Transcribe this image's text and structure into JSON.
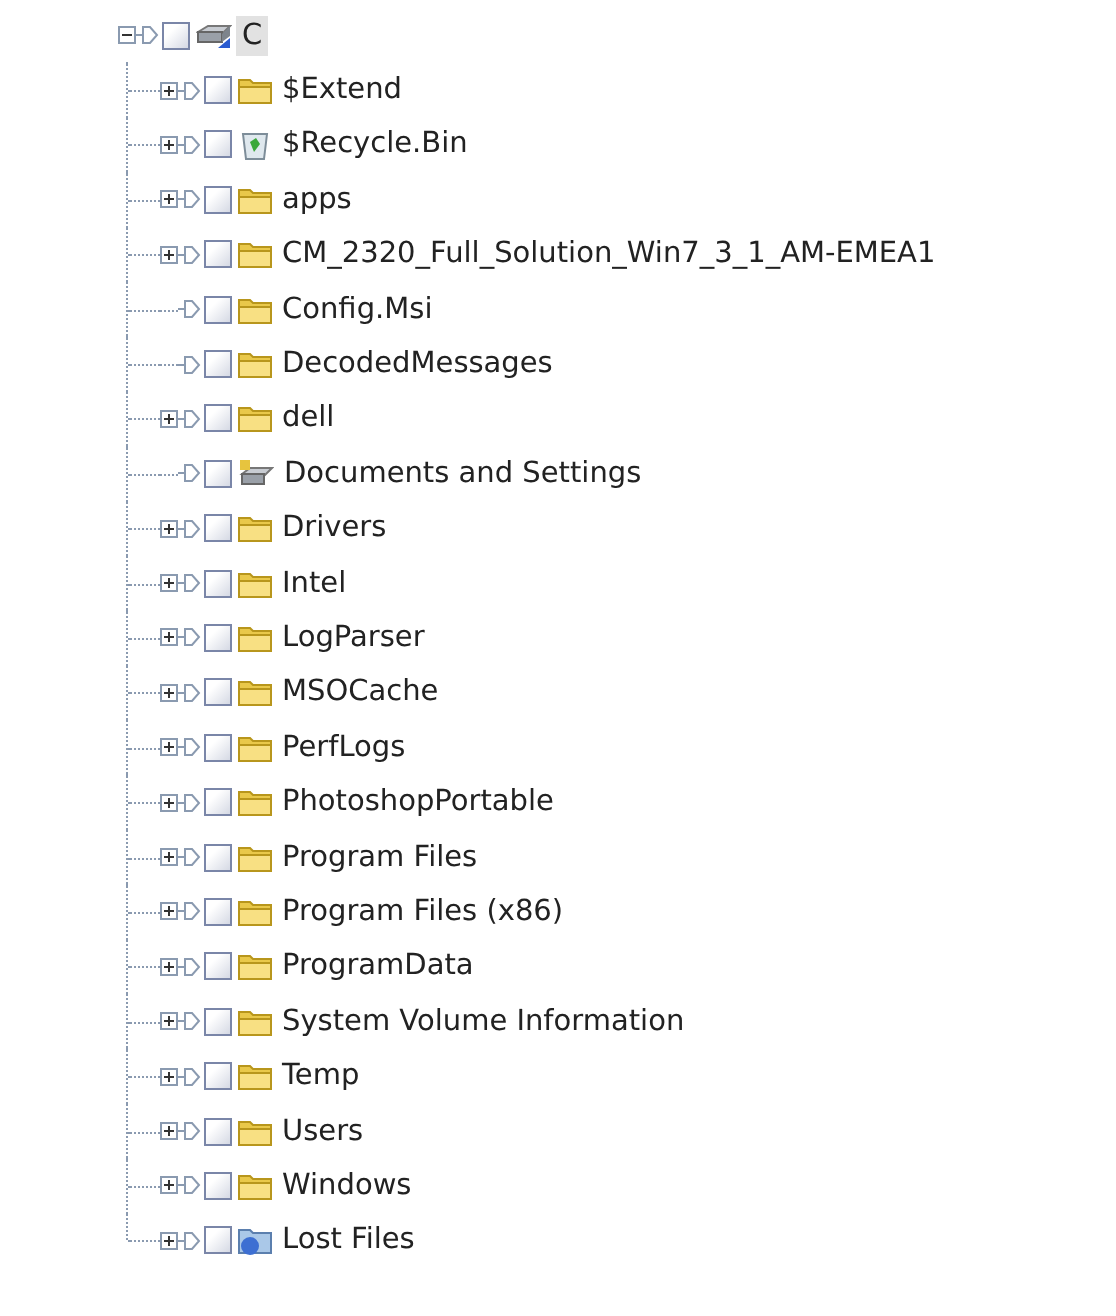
{
  "tree": {
    "label": "C",
    "kind": "drive",
    "selected": true,
    "expanded": true,
    "checked": false,
    "children": [
      {
        "label": "$Extend",
        "kind": "folder",
        "has_children": true,
        "checked": false,
        "selected": false
      },
      {
        "label": "$Recycle.Bin",
        "kind": "recycle",
        "has_children": true,
        "checked": false,
        "selected": false
      },
      {
        "label": "apps",
        "kind": "folder",
        "has_children": true,
        "checked": false,
        "selected": false
      },
      {
        "label": "CM_2320_Full_Solution_Win7_3_1_AM-EMEA1",
        "kind": "folder",
        "has_children": true,
        "checked": false,
        "selected": false
      },
      {
        "label": "Config.Msi",
        "kind": "folder",
        "has_children": false,
        "checked": false,
        "selected": false
      },
      {
        "label": "DecodedMessages",
        "kind": "folder",
        "has_children": false,
        "checked": false,
        "selected": false
      },
      {
        "label": "dell",
        "kind": "folder",
        "has_children": true,
        "checked": false,
        "selected": false
      },
      {
        "label": "Documents and Settings",
        "kind": "link",
        "has_children": false,
        "checked": false,
        "selected": false
      },
      {
        "label": "Drivers",
        "kind": "folder",
        "has_children": true,
        "checked": false,
        "selected": false
      },
      {
        "label": "Intel",
        "kind": "folder",
        "has_children": true,
        "checked": false,
        "selected": false
      },
      {
        "label": "LogParser",
        "kind": "folder",
        "has_children": true,
        "checked": false,
        "selected": false
      },
      {
        "label": "MSOCache",
        "kind": "folder",
        "has_children": true,
        "checked": false,
        "selected": false
      },
      {
        "label": "PerfLogs",
        "kind": "folder",
        "has_children": true,
        "checked": false,
        "selected": false
      },
      {
        "label": "PhotoshopPortable",
        "kind": "folder",
        "has_children": true,
        "checked": false,
        "selected": false
      },
      {
        "label": "Program Files",
        "kind": "folder",
        "has_children": true,
        "checked": false,
        "selected": false
      },
      {
        "label": "Program Files (x86)",
        "kind": "folder",
        "has_children": true,
        "checked": false,
        "selected": false
      },
      {
        "label": "ProgramData",
        "kind": "folder",
        "has_children": true,
        "checked": false,
        "selected": false
      },
      {
        "label": "System Volume Information",
        "kind": "folder",
        "has_children": true,
        "checked": false,
        "selected": false
      },
      {
        "label": "Temp",
        "kind": "folder",
        "has_children": true,
        "checked": false,
        "selected": false
      },
      {
        "label": "Users",
        "kind": "folder",
        "has_children": true,
        "checked": false,
        "selected": false
      },
      {
        "label": "Windows",
        "kind": "folder",
        "has_children": true,
        "checked": false,
        "selected": false
      },
      {
        "label": "Lost Files",
        "kind": "lost",
        "has_children": true,
        "checked": false,
        "selected": false
      }
    ]
  }
}
